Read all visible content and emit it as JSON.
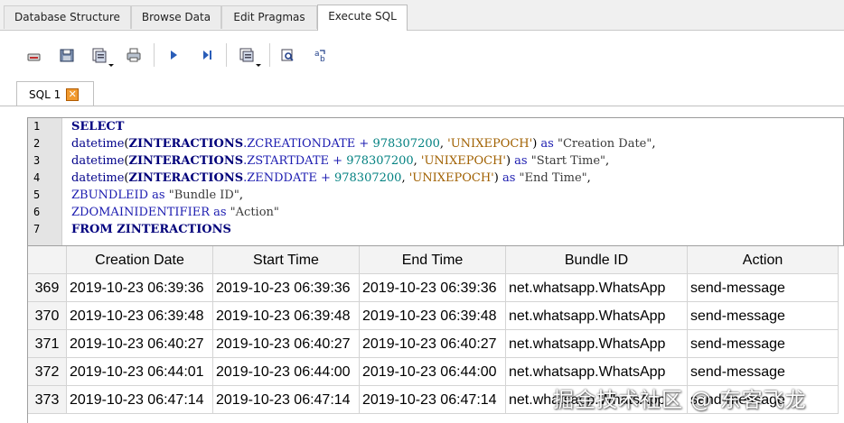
{
  "main_tabs": [
    {
      "label": "Database Structure"
    },
    {
      "label": "Browse Data"
    },
    {
      "label": "Edit Pragmas"
    },
    {
      "label": "Execute SQL",
      "active": true
    }
  ],
  "toolbar_icons": [
    "open-tab-icon",
    "open-sql-file-icon",
    "save-sql-file-icon",
    "print-icon",
    "execute-all-icon",
    "execute-line-icon",
    "save-results-icon",
    "find-icon",
    "find-replace-icon"
  ],
  "sql_tab": {
    "label": "SQL 1",
    "close_symbol": "✕",
    "accent": "#f19a2f"
  },
  "editor": {
    "line_numbers": [
      "1",
      "2",
      "3",
      "4",
      "5",
      "6",
      "7"
    ],
    "lines": [
      [
        {
          "t": "SELECT",
          "c": "kw"
        }
      ],
      [
        {
          "t": "datetime",
          "c": "fn"
        },
        {
          "t": "(",
          "c": "op"
        },
        {
          "t": "ZINTERACTIONS",
          "c": "idb"
        },
        {
          "t": ".ZCREATIONDATE + ",
          "c": "id"
        },
        {
          "t": "978307200",
          "c": "num"
        },
        {
          "t": ", ",
          "c": "op"
        },
        {
          "t": "'UNIXEPOCH'",
          "c": "str"
        },
        {
          "t": ") ",
          "c": "op"
        },
        {
          "t": "as",
          "c": "id"
        },
        {
          "t": " \"Creation Date\"",
          "c": "dq"
        },
        {
          "t": ",",
          "c": "op"
        }
      ],
      [
        {
          "t": "datetime",
          "c": "fn"
        },
        {
          "t": "(",
          "c": "op"
        },
        {
          "t": "ZINTERACTIONS",
          "c": "idb"
        },
        {
          "t": ".ZSTARTDATE + ",
          "c": "id"
        },
        {
          "t": "978307200",
          "c": "num"
        },
        {
          "t": ", ",
          "c": "op"
        },
        {
          "t": "'UNIXEPOCH'",
          "c": "str"
        },
        {
          "t": ") ",
          "c": "op"
        },
        {
          "t": "as",
          "c": "id"
        },
        {
          "t": " \"Start Time\"",
          "c": "dq"
        },
        {
          "t": ",",
          "c": "op"
        }
      ],
      [
        {
          "t": "datetime",
          "c": "fn"
        },
        {
          "t": "(",
          "c": "op"
        },
        {
          "t": "ZINTERACTIONS",
          "c": "idb"
        },
        {
          "t": ".ZENDDATE + ",
          "c": "id"
        },
        {
          "t": "978307200",
          "c": "num"
        },
        {
          "t": ", ",
          "c": "op"
        },
        {
          "t": "'UNIXEPOCH'",
          "c": "str"
        },
        {
          "t": ") ",
          "c": "op"
        },
        {
          "t": "as",
          "c": "id"
        },
        {
          "t": " \"End Time\"",
          "c": "dq"
        },
        {
          "t": ",",
          "c": "op"
        }
      ],
      [
        {
          "t": "ZBUNDLEID ",
          "c": "id"
        },
        {
          "t": "as",
          "c": "id"
        },
        {
          "t": " \"Bundle ID\"",
          "c": "dq"
        },
        {
          "t": ",",
          "c": "op"
        }
      ],
      [
        {
          "t": "ZDOMAINIDENTIFIER ",
          "c": "id"
        },
        {
          "t": "as",
          "c": "id"
        },
        {
          "t": " \"Action\"",
          "c": "dq"
        }
      ],
      [
        {
          "t": "FROM ",
          "c": "kw"
        },
        {
          "t": "ZINTERACTIONS",
          "c": "idb"
        }
      ]
    ]
  },
  "results": {
    "columns": [
      "Creation Date",
      "Start Time",
      "End Time",
      "Bundle ID",
      "Action"
    ],
    "rows": [
      {
        "num": "369",
        "cells": [
          "2019-10-23 06:39:36",
          "2019-10-23 06:39:36",
          "2019-10-23 06:39:36",
          "net.whatsapp.WhatsApp",
          "send-message"
        ]
      },
      {
        "num": "370",
        "cells": [
          "2019-10-23 06:39:48",
          "2019-10-23 06:39:48",
          "2019-10-23 06:39:48",
          "net.whatsapp.WhatsApp",
          "send-message"
        ]
      },
      {
        "num": "371",
        "cells": [
          "2019-10-23 06:40:27",
          "2019-10-23 06:40:27",
          "2019-10-23 06:40:27",
          "net.whatsapp.WhatsApp",
          "send-message"
        ]
      },
      {
        "num": "372",
        "cells": [
          "2019-10-23 06:44:01",
          "2019-10-23 06:44:00",
          "2019-10-23 06:44:00",
          "net.whatsapp.WhatsApp",
          "send-message"
        ]
      },
      {
        "num": "373",
        "cells": [
          "2019-10-23 06:47:14",
          "2019-10-23 06:47:14",
          "2019-10-23 06:47:14",
          "net.whatsapp.WhatsApp",
          "send-message"
        ]
      }
    ]
  },
  "watermark": "掘金技术社区 @ 东客飞龙"
}
